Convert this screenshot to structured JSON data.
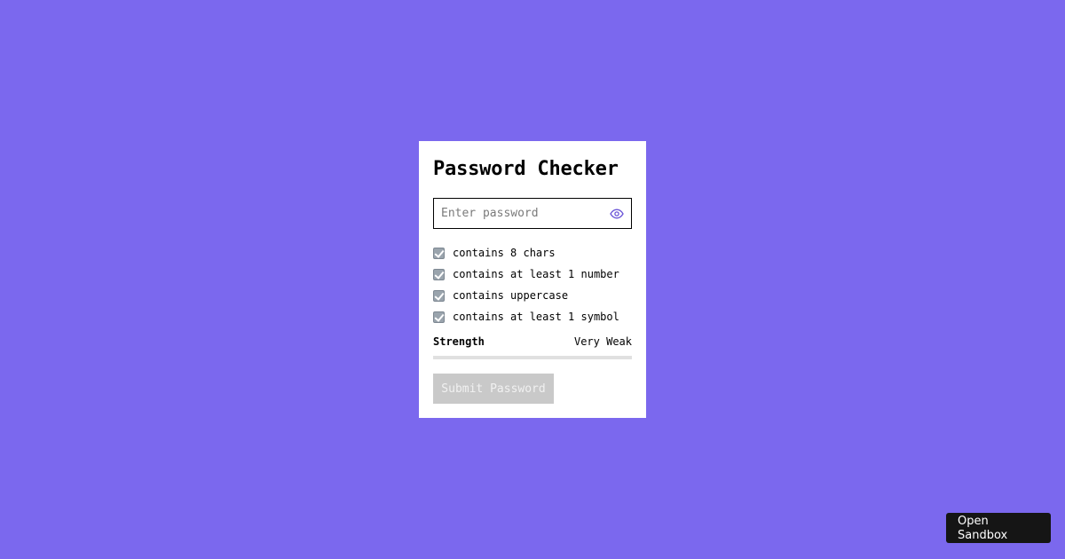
{
  "card": {
    "title": "Password Checker",
    "password_placeholder": "Enter password",
    "password_value": "",
    "rules": [
      "contains 8 chars",
      "contains at least 1 number",
      "contains uppercase",
      "contains at least 1 symbol"
    ],
    "strength_label": "Strength",
    "strength_value": "Very Weak",
    "strength_fraction": 0,
    "submit_label": "Submit Password"
  },
  "footer": {
    "sandbox_label": "Open Sandbox"
  },
  "colors": {
    "background": "#7b68ee",
    "card": "#ffffff",
    "disabled_button": "#c9c9c9",
    "sandbox_button": "#151515"
  },
  "icons": {
    "toggle_visibility": "eye-icon",
    "rule_status": "check-icon"
  }
}
